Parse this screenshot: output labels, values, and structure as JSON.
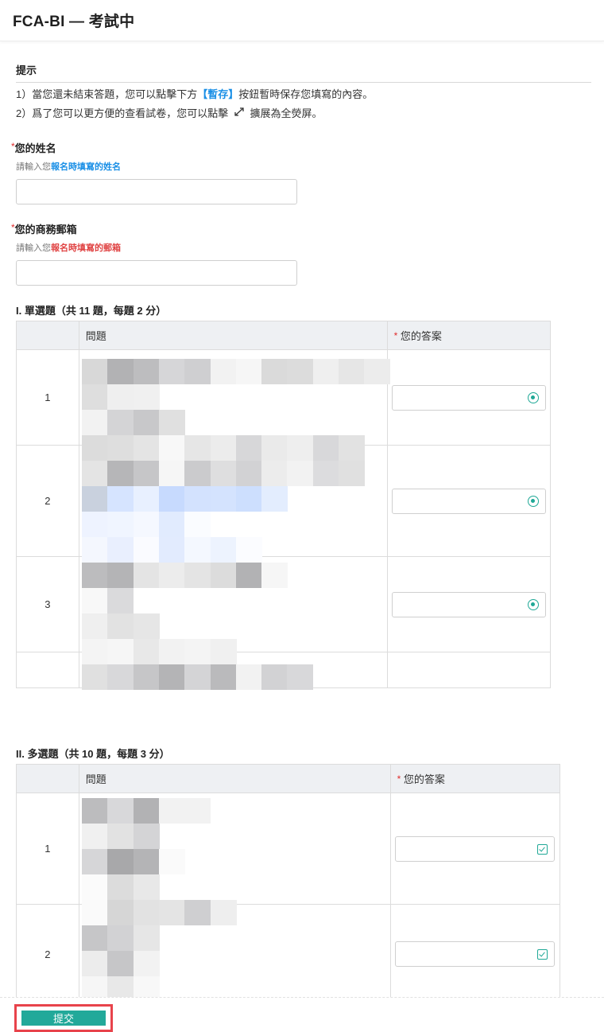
{
  "header": {
    "title": "FCA-BI — 考試中"
  },
  "hint": {
    "title": "提示",
    "line1_pre": "1）當您還未結束答題，您可以點擊下方",
    "line1_highlight": "【暫存】",
    "line1_post": "按鈕暫時保存您填寫的內容。",
    "line2_pre": "2）爲了您可以更方便的查看試卷，您可以點擊",
    "line2_icon": "expand-icon",
    "line2_post": "擴展為全熒屏。"
  },
  "name_field": {
    "required_mark": "*",
    "label": "您的姓名",
    "help_pre": "請輸入您",
    "help_emphasis": "報名時填寫的姓名",
    "value": ""
  },
  "email_field": {
    "required_mark": "*",
    "label": "您的商務郵箱",
    "help_pre": "請輸入您",
    "help_emphasis": "報名時填寫的郵箱",
    "value": ""
  },
  "section1": {
    "title": "I. 單選題（共 11 題，每題 2 分）",
    "col_question": "問題",
    "col_answer_mark": "*",
    "col_answer": "您的答案",
    "rows": [
      {
        "num": "1",
        "answer": ""
      },
      {
        "num": "2",
        "answer": ""
      },
      {
        "num": "3",
        "answer": ""
      },
      {
        "num": "",
        "answer": ""
      }
    ]
  },
  "section2": {
    "title": "II. 多選題（共 10 題，每題 3 分）",
    "col_question": "問題",
    "col_answer_mark": "*",
    "col_answer": "您的答案",
    "rows": [
      {
        "num": "1",
        "answer": ""
      },
      {
        "num": "2",
        "answer": ""
      }
    ]
  },
  "footer": {
    "submit_label": "提交"
  },
  "colors": {
    "accent": "#22a99a",
    "link_blue": "#1a8fe6",
    "required_red": "#e02c2c",
    "highlight_outline": "#e8434b"
  }
}
